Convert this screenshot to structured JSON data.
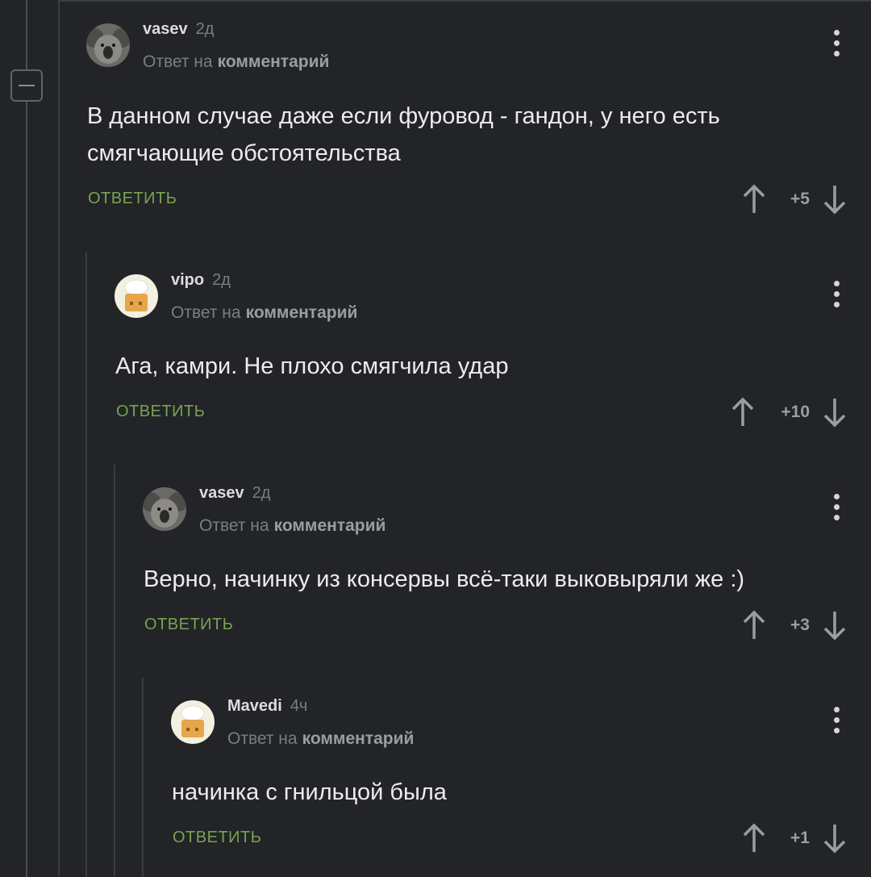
{
  "comments": [
    {
      "user": "vasev",
      "time": "2д",
      "reply_prefix": "Ответ на",
      "reply_link": "комментарий",
      "text": "В данном случае даже если фуровод - гандон, у него есть смягчающие обстоятельства",
      "reply_label": "ОТВЕТИТЬ",
      "score": "+5",
      "avatar": "koala-avatar"
    },
    {
      "user": "vipo",
      "time": "2д",
      "reply_prefix": "Ответ на",
      "reply_link": "комментарий",
      "text": "Ага, камри. Не плохо смягчила удар",
      "reply_label": "ОТВЕТИТЬ",
      "score": "+10",
      "avatar": "cake-avatar"
    },
    {
      "user": "vasev",
      "time": "2д",
      "reply_prefix": "Ответ на",
      "reply_link": "комментарий",
      "text": "Верно, начинку из консервы всё-таки выковыряли же :)",
      "reply_label": "ОТВЕТИТЬ",
      "score": "+3",
      "avatar": "koala-avatar"
    },
    {
      "user": "Mavedi",
      "time": "4ч",
      "reply_prefix": "Ответ на",
      "reply_link": "комментарий",
      "text": "начинка с гнильцой была",
      "reply_label": "ОТВЕТИТЬ",
      "score": "+1",
      "avatar": "cake-avatar"
    }
  ],
  "colors": {
    "background": "#222427",
    "reply_green": "#79a352",
    "muted": "#7a7e83"
  }
}
